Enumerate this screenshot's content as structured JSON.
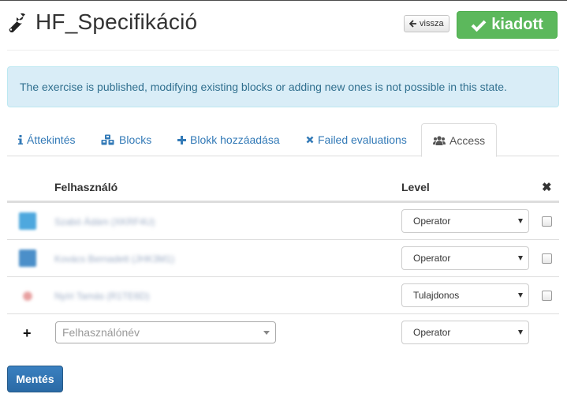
{
  "header": {
    "title": "HF_Specifikáció",
    "back_label": "vissza",
    "status_label": "kiadott",
    "status_color": "#5cb85c"
  },
  "alert": {
    "text": "The exercise is published, modifying existing blocks or adding new ones is not possible in this state."
  },
  "tabs": [
    {
      "label": "Áttekintés",
      "icon": "info-icon"
    },
    {
      "label": "Blocks",
      "icon": "cubes-icon"
    },
    {
      "label": "Blokk hozzáadása",
      "icon": "plus-icon"
    },
    {
      "label": "Failed evaluations",
      "icon": "times-icon"
    },
    {
      "label": "Access",
      "icon": "users-icon",
      "active": true
    }
  ],
  "table": {
    "col_user": "Felhasználó",
    "col_level": "Level",
    "col_remove": "✖",
    "rows": [
      {
        "user": "Szabó Ádám (XKRF4U)",
        "level": "Operator"
      },
      {
        "user": "Kovács Bernadett (JHK3M1)",
        "level": "Operator"
      },
      {
        "user": "Nyíri Tamás (R1TE6D)",
        "level": "Tulajdonos"
      }
    ],
    "new_row": {
      "add_symbol": "+",
      "user_placeholder": "Felhasználónév",
      "level": "Operator"
    }
  },
  "save_label": "Mentés"
}
